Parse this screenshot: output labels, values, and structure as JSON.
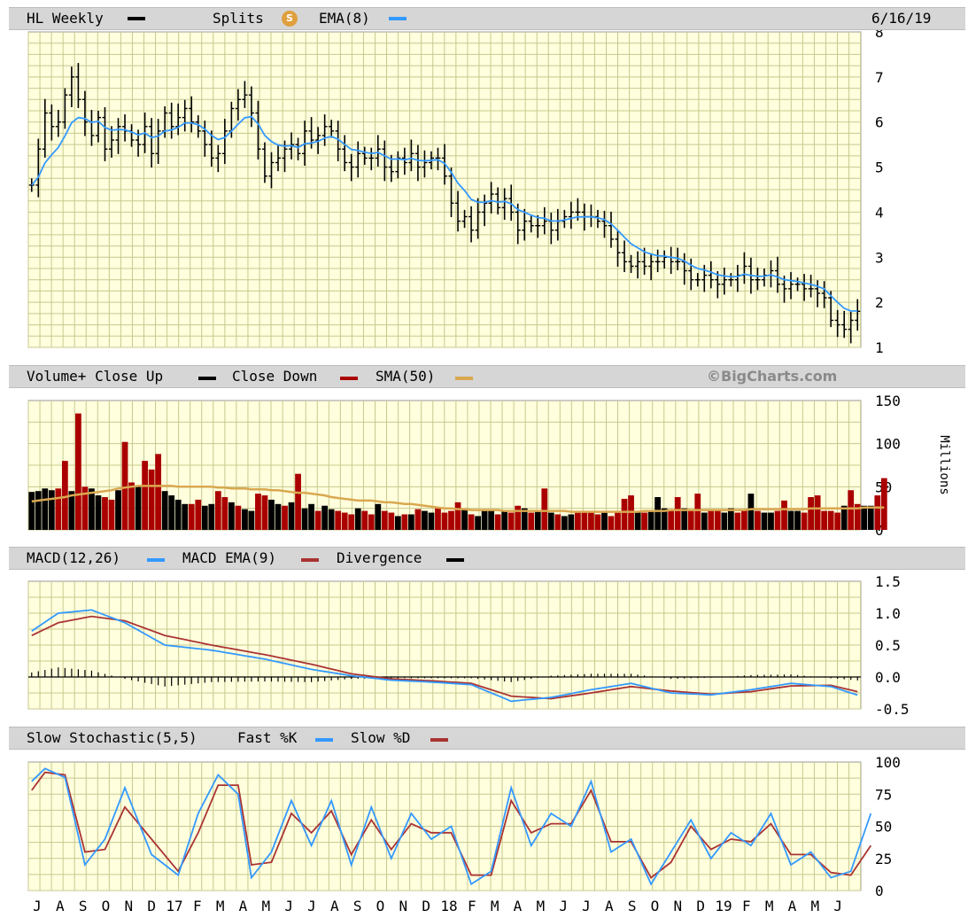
{
  "header": {
    "symbol_label": "HL Weekly",
    "splits_label": "Splits",
    "splits_icon_letter": "S",
    "ema_label": "EMA(8)",
    "date": "6/16/19"
  },
  "volume_header": {
    "label_a": "Volume+ Close Up",
    "label_b": "Close Down",
    "label_c": "SMA(50)",
    "brand": "©BigCharts.com"
  },
  "macd_header": {
    "label_a": "MACD(12,26)",
    "label_b": "MACD EMA(9)",
    "label_c": "Divergence"
  },
  "stoch_header": {
    "label_a": "Slow Stochastic(5,5)",
    "label_b": "Fast %K",
    "label_c": "Slow %D"
  },
  "colors": {
    "panel_bg": "#ffffdd",
    "grid": "#c8c890",
    "price_bar": "#000000",
    "ema": "#3399ff",
    "up_volume": "#000000",
    "down_volume": "#aa0000",
    "sma": "#d9a850",
    "macd": "#3399ff",
    "macd_ema": "#aa3333",
    "divergence": "#000000",
    "fast_k": "#3399ff",
    "slow_d": "#aa3333"
  },
  "chart_data": [
    {
      "type": "ohlc",
      "title": "HL Weekly",
      "ylim": [
        1,
        8
      ],
      "ticks": [
        1,
        2,
        3,
        4,
        5,
        6,
        7,
        8
      ],
      "x_labels": [
        "J",
        "A",
        "S",
        "O",
        "N",
        "D",
        "17",
        "F",
        "M",
        "A",
        "M",
        "J",
        "J",
        "A",
        "S",
        "O",
        "N",
        "D",
        "18",
        "F",
        "M",
        "A",
        "M",
        "J",
        "J",
        "A",
        "S",
        "O",
        "N",
        "D",
        "19",
        "F",
        "M",
        "A",
        "M",
        "J"
      ],
      "close": [
        4.6,
        5.4,
        6.2,
        5.9,
        6.0,
        6.6,
        7.0,
        6.5,
        6.0,
        5.7,
        6.1,
        5.4,
        5.6,
        5.9,
        5.8,
        5.6,
        5.5,
        5.9,
        5.3,
        5.8,
        6.2,
        5.9,
        6.1,
        6.3,
        6.0,
        5.8,
        5.5,
        5.2,
        5.3,
        5.8,
        6.3,
        6.5,
        6.6,
        6.2,
        5.4,
        4.8,
        5.1,
        5.2,
        5.4,
        5.5,
        5.3,
        5.8,
        5.6,
        5.7,
        5.9,
        5.8,
        5.4,
        5.1,
        5.0,
        5.3,
        5.2,
        5.2,
        5.4,
        5.0,
        4.9,
        5.2,
        5.1,
        5.3,
        5.0,
        5.1,
        5.2,
        5.2,
        4.8,
        4.2,
        3.8,
        3.9,
        3.6,
        4.0,
        4.2,
        4.4,
        4.1,
        4.3,
        4.0,
        3.6,
        3.8,
        3.7,
        3.7,
        3.8,
        3.6,
        3.8,
        3.9,
        4.0,
        4.0,
        3.9,
        3.9,
        3.8,
        3.7,
        3.4,
        3.1,
        2.9,
        2.8,
        2.9,
        2.8,
        2.9,
        2.9,
        3.0,
        2.9,
        2.9,
        2.7,
        2.5,
        2.5,
        2.6,
        2.5,
        2.4,
        2.5,
        2.5,
        2.6,
        2.8,
        2.5,
        2.5,
        2.6,
        2.7,
        2.4,
        2.3,
        2.4,
        2.4,
        2.3,
        2.3,
        2.2,
        2.1,
        1.6,
        1.5,
        1.4,
        1.6,
        1.8
      ],
      "ema8_note": "EMA(8)"
    },
    {
      "type": "bar",
      "title": "Volume",
      "unit": "Millions",
      "ylim": [
        0,
        150
      ],
      "ticks": [
        0,
        50,
        100,
        150
      ],
      "values": [
        44,
        45,
        48,
        46,
        48,
        80,
        45,
        135,
        50,
        48,
        40,
        38,
        35,
        46,
        102,
        55,
        50,
        80,
        70,
        88,
        45,
        40,
        35,
        30,
        30,
        35,
        28,
        30,
        45,
        38,
        32,
        28,
        24,
        22,
        42,
        40,
        35,
        30,
        28,
        32,
        65,
        25,
        30,
        22,
        28,
        24,
        22,
        20,
        18,
        25,
        22,
        18,
        30,
        22,
        20,
        16,
        18,
        18,
        24,
        22,
        20,
        25,
        20,
        22,
        32,
        25,
        18,
        16,
        22,
        24,
        18,
        22,
        20,
        28,
        25,
        20,
        22,
        48,
        20,
        18,
        16,
        18,
        20,
        22,
        20,
        18,
        20,
        16,
        22,
        36,
        40,
        20,
        20,
        22,
        38,
        25,
        24,
        38,
        25,
        22,
        42,
        20,
        22,
        24,
        20,
        25,
        20,
        24,
        42,
        22,
        20,
        20,
        22,
        34,
        22,
        22,
        20,
        38,
        40,
        22,
        22,
        20,
        28,
        46,
        30,
        28,
        28,
        40,
        60
      ],
      "up": [
        1,
        1,
        1,
        1,
        0,
        0,
        1,
        0,
        0,
        1,
        1,
        0,
        0,
        1,
        0,
        0,
        1,
        0,
        0,
        0,
        1,
        1,
        1,
        1,
        0,
        0,
        1,
        1,
        0,
        0,
        1,
        0,
        1,
        1,
        0,
        0,
        1,
        1,
        0,
        1,
        0,
        1,
        1,
        0,
        1,
        1,
        0,
        0,
        0,
        1,
        0,
        0,
        1,
        0,
        0,
        1,
        0,
        1,
        0,
        1,
        1,
        0,
        0,
        0,
        0,
        1,
        0,
        1,
        1,
        1,
        0,
        1,
        0,
        0,
        1,
        0,
        1,
        0,
        1,
        0,
        1,
        1,
        0,
        0,
        0,
        0,
        1,
        0,
        0,
        0,
        0,
        1,
        0,
        1,
        1,
        1,
        0,
        0,
        1,
        0,
        0,
        1,
        0,
        0,
        1,
        1,
        0,
        0,
        1,
        0,
        1,
        1,
        0,
        0,
        1,
        1,
        0,
        0,
        0,
        0,
        0,
        0,
        1,
        0,
        0,
        1,
        1
      ],
      "sma50": [
        33,
        34,
        35,
        36,
        37,
        38,
        40,
        41,
        42,
        43,
        44,
        45,
        46,
        48,
        49,
        50,
        51,
        51,
        51,
        51,
        51,
        51,
        50,
        50,
        50,
        50,
        50,
        50,
        49,
        49,
        48,
        48,
        48,
        47,
        47,
        47,
        46,
        46,
        45,
        44,
        43,
        43,
        42,
        41,
        40,
        38,
        37,
        36,
        35,
        34,
        34,
        34,
        33,
        32,
        32,
        31,
        30,
        30,
        29,
        28,
        27,
        26,
        25,
        25,
        24,
        24,
        23,
        23,
        23,
        23,
        23,
        22,
        22,
        22,
        22,
        22,
        22,
        22,
        22,
        22,
        22,
        21,
        21,
        21,
        21,
        21,
        21,
        21,
        21,
        21,
        21,
        21,
        22,
        22,
        22,
        22,
        23,
        23,
        23,
        23,
        23,
        23,
        23,
        23,
        23,
        23,
        23,
        23,
        24,
        24,
        24,
        24,
        24,
        24,
        24,
        24,
        24,
        25,
        25,
        25,
        25,
        25,
        25,
        25,
        25,
        26,
        26,
        26,
        26
      ]
    },
    {
      "type": "line",
      "title": "MACD(12,26)",
      "ylim": [
        -0.5,
        1.5
      ],
      "ticks": [
        -0.5,
        0.0,
        0.5,
        1.0,
        1.5
      ],
      "series": [
        {
          "name": "MACD(12,26)",
          "x": [
            0,
            4,
            9,
            14,
            20,
            27,
            35,
            42,
            48,
            54,
            60,
            66,
            72,
            78,
            84,
            90,
            96,
            102,
            108,
            114,
            120,
            126
          ],
          "values": [
            0.72,
            1.0,
            1.05,
            0.85,
            0.5,
            0.42,
            0.28,
            0.12,
            0.02,
            -0.05,
            -0.08,
            -0.12,
            -0.38,
            -0.32,
            -0.2,
            -0.1,
            -0.25,
            -0.28,
            -0.2,
            -0.1,
            -0.15,
            -0.35
          ]
        },
        {
          "name": "MACD EMA(9)",
          "x": [
            0,
            4,
            9,
            14,
            20,
            27,
            35,
            42,
            48,
            54,
            60,
            66,
            72,
            78,
            84,
            90,
            96,
            102,
            108,
            114,
            120,
            126
          ],
          "values": [
            0.65,
            0.85,
            0.95,
            0.88,
            0.65,
            0.5,
            0.35,
            0.2,
            0.05,
            -0.03,
            -0.06,
            -0.1,
            -0.3,
            -0.34,
            -0.25,
            -0.15,
            -0.22,
            -0.27,
            -0.23,
            -0.14,
            -0.13,
            -0.28
          ]
        },
        {
          "name": "Divergence",
          "x": [
            0,
            4,
            9,
            14,
            20,
            27,
            35,
            42,
            48,
            54,
            60,
            66,
            72,
            78,
            84,
            90,
            96,
            102,
            108,
            114,
            120,
            126
          ],
          "values": [
            0.07,
            0.15,
            0.1,
            -0.03,
            -0.15,
            -0.08,
            -0.07,
            -0.08,
            -0.03,
            -0.02,
            -0.02,
            -0.02,
            -0.08,
            0.02,
            0.05,
            0.05,
            -0.03,
            -0.01,
            0.03,
            0.04,
            -0.02,
            -0.07
          ]
        }
      ]
    },
    {
      "type": "line",
      "title": "Slow Stochastic(5,5)",
      "ylim": [
        0,
        100
      ],
      "ticks": [
        0,
        25,
        50,
        75,
        100
      ],
      "series": [
        {
          "name": "Fast %K",
          "x": [
            0,
            2,
            5,
            8,
            11,
            14,
            18,
            22,
            25,
            28,
            31,
            33,
            36,
            39,
            42,
            45,
            48,
            51,
            54,
            57,
            60,
            63,
            66,
            69,
            72,
            75,
            78,
            81,
            84,
            87,
            90,
            93,
            96,
            99,
            102,
            105,
            108,
            111,
            114,
            117,
            120,
            123,
            126
          ],
          "values": [
            85,
            95,
            88,
            20,
            40,
            80,
            28,
            12,
            60,
            90,
            75,
            10,
            30,
            70,
            35,
            70,
            20,
            65,
            25,
            60,
            40,
            50,
            5,
            15,
            80,
            35,
            60,
            50,
            85,
            30,
            40,
            5,
            30,
            55,
            25,
            45,
            35,
            60,
            20,
            30,
            10,
            15,
            60
          ]
        },
        {
          "name": "Slow %D",
          "x": [
            0,
            2,
            5,
            8,
            11,
            14,
            18,
            22,
            25,
            28,
            31,
            33,
            36,
            39,
            42,
            45,
            48,
            51,
            54,
            57,
            60,
            63,
            66,
            69,
            72,
            75,
            78,
            81,
            84,
            87,
            90,
            93,
            96,
            99,
            102,
            105,
            108,
            111,
            114,
            117,
            120,
            123,
            126
          ],
          "values": [
            78,
            92,
            90,
            30,
            32,
            65,
            40,
            15,
            45,
            82,
            82,
            20,
            22,
            60,
            45,
            62,
            28,
            55,
            32,
            52,
            45,
            45,
            12,
            12,
            70,
            45,
            52,
            52,
            78,
            38,
            38,
            10,
            22,
            50,
            32,
            40,
            38,
            52,
            28,
            28,
            14,
            12,
            35
          ]
        }
      ]
    }
  ]
}
